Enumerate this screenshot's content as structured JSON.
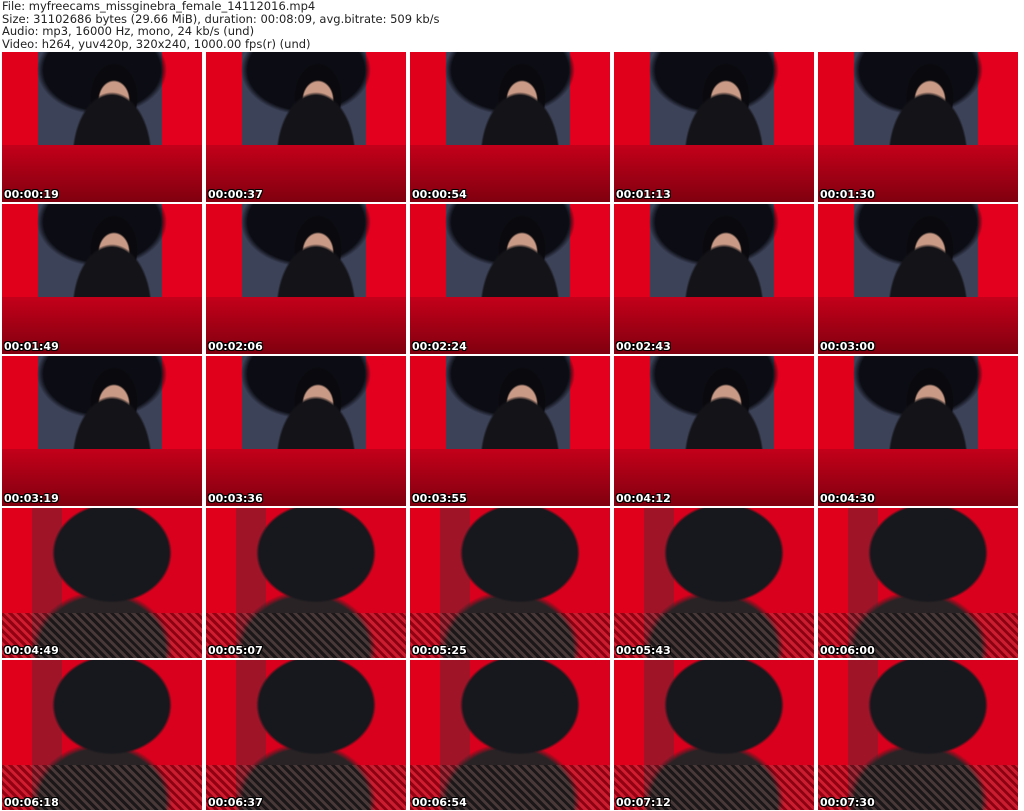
{
  "header": {
    "file": "File: myfreecams_missginebra_female_14112016.mp4",
    "size": "Size: 31102686 bytes (29.66 MiB), duration: 00:08:09, avg.bitrate: 509 kb/s",
    "audio": "Audio: mp3, 16000 Hz, mono, 24 kb/s (und)",
    "video": "Video: h264, yuv420p, 320x240, 1000.00 fps(r) (und)"
  },
  "thumbnails": [
    {
      "timestamp": "00:00:19",
      "scene": "a"
    },
    {
      "timestamp": "00:00:37",
      "scene": "a"
    },
    {
      "timestamp": "00:00:54",
      "scene": "a"
    },
    {
      "timestamp": "00:01:13",
      "scene": "a"
    },
    {
      "timestamp": "00:01:30",
      "scene": "a"
    },
    {
      "timestamp": "00:01:49",
      "scene": "a"
    },
    {
      "timestamp": "00:02:06",
      "scene": "a"
    },
    {
      "timestamp": "00:02:24",
      "scene": "a"
    },
    {
      "timestamp": "00:02:43",
      "scene": "a"
    },
    {
      "timestamp": "00:03:00",
      "scene": "a"
    },
    {
      "timestamp": "00:03:19",
      "scene": "a"
    },
    {
      "timestamp": "00:03:36",
      "scene": "a"
    },
    {
      "timestamp": "00:03:55",
      "scene": "a"
    },
    {
      "timestamp": "00:04:12",
      "scene": "a"
    },
    {
      "timestamp": "00:04:30",
      "scene": "a"
    },
    {
      "timestamp": "00:04:49",
      "scene": "b"
    },
    {
      "timestamp": "00:05:07",
      "scene": "b"
    },
    {
      "timestamp": "00:05:25",
      "scene": "b"
    },
    {
      "timestamp": "00:05:43",
      "scene": "b"
    },
    {
      "timestamp": "00:06:00",
      "scene": "b"
    },
    {
      "timestamp": "00:06:18",
      "scene": "b"
    },
    {
      "timestamp": "00:06:37",
      "scene": "b"
    },
    {
      "timestamp": "00:06:54",
      "scene": "b"
    },
    {
      "timestamp": "00:07:12",
      "scene": "b"
    },
    {
      "timestamp": "00:07:30",
      "scene": "b"
    }
  ]
}
